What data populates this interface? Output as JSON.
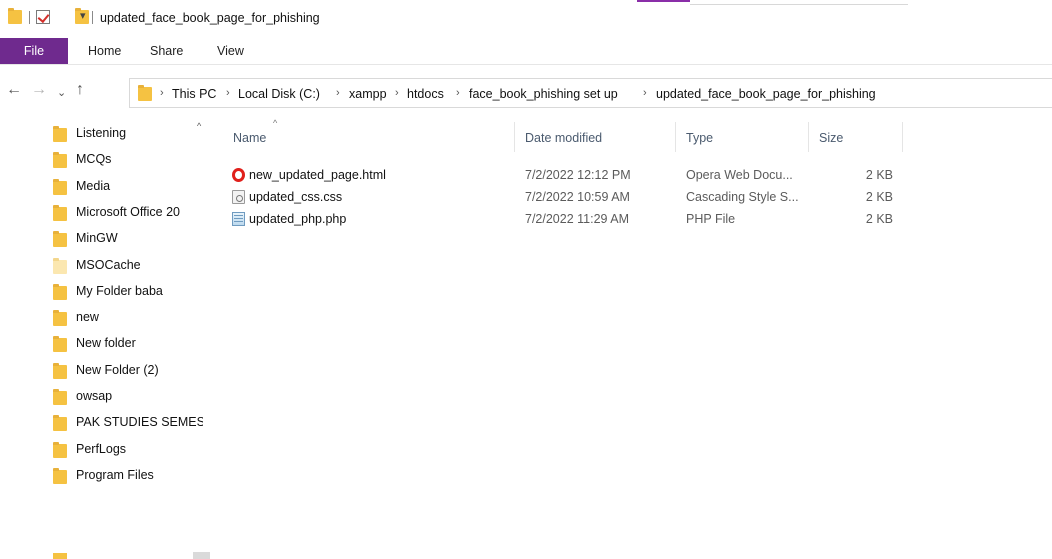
{
  "window": {
    "title": "updated_face_book_page_for_phishing"
  },
  "ribbon": {
    "tabs": [
      "File",
      "Home",
      "Share",
      "View"
    ]
  },
  "address": {
    "crumbs": [
      "This PC",
      "Local Disk (C:)",
      "xampp",
      "htdocs",
      "face_book_phishing set up",
      "updated_face_book_page_for_phishing"
    ]
  },
  "nav_pane": {
    "items": [
      {
        "label": "Listening",
        "icon": "folder-icon"
      },
      {
        "label": "MCQs",
        "icon": "folder-icon"
      },
      {
        "label": "Media",
        "icon": "folder-icon"
      },
      {
        "label": "Microsoft Office 20",
        "icon": "folder-icon"
      },
      {
        "label": "MinGW",
        "icon": "folder-icon"
      },
      {
        "label": "MSOCache",
        "icon": "folder-light-icon"
      },
      {
        "label": "My Folder baba",
        "icon": "folder-icon"
      },
      {
        "label": "new",
        "icon": "folder-icon"
      },
      {
        "label": "New folder",
        "icon": "folder-icon"
      },
      {
        "label": "New Folder (2)",
        "icon": "folder-icon"
      },
      {
        "label": "owsap",
        "icon": "folder-icon"
      },
      {
        "label": "PAK STUDIES SEMES",
        "icon": "folder-icon"
      },
      {
        "label": "PerfLogs",
        "icon": "folder-icon"
      },
      {
        "label": "Program Files",
        "icon": "folder-icon"
      }
    ]
  },
  "file_list": {
    "columns": [
      "Name",
      "Date modified",
      "Type",
      "Size"
    ],
    "rows": [
      {
        "name": "new_updated_page.html",
        "date": "7/2/2022 12:12 PM",
        "type": "Opera Web Docu...",
        "size": "2 KB",
        "icon": "opera-icon"
      },
      {
        "name": "updated_css.css",
        "date": "7/2/2022 10:59 AM",
        "type": "Cascading Style S...",
        "size": "2 KB",
        "icon": "css-file-icon"
      },
      {
        "name": "updated_php.php",
        "date": "7/2/2022 11:29 AM",
        "type": "PHP File",
        "size": "2 KB",
        "icon": "php-file-icon"
      }
    ]
  },
  "colors": {
    "file_tab": "#6f2a8e",
    "folder": "#f5c242",
    "accent_line": "#8a2ea8"
  }
}
